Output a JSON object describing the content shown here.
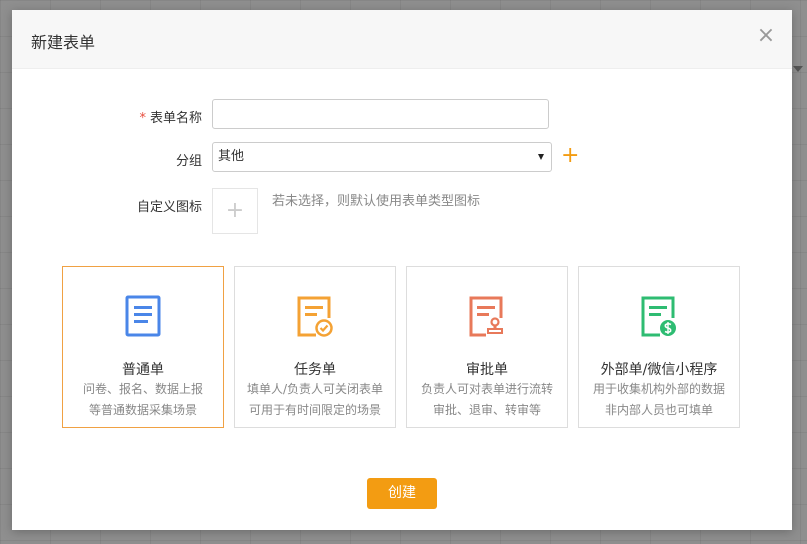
{
  "dialog": {
    "title": "新建表单",
    "close": "×"
  },
  "form": {
    "name_label": "表单名称",
    "required_mark": "*",
    "name_value": "",
    "group_label": "分组",
    "group_value": "其他",
    "add_group": "+",
    "icon_label": "自定义图标",
    "icon_add": "+",
    "icon_hint": "若未选择，则默认使用表单类型图标"
  },
  "cards": [
    {
      "title": "普通单",
      "desc1": "问卷、报名、数据上报",
      "desc2": "等普通数据采集场景",
      "icon": "document-icon",
      "color": "#4a86e8",
      "selected": true
    },
    {
      "title": "任务单",
      "desc1": "填单人/负责人可关闭表单",
      "desc2": "可用于有时间限定的场景",
      "icon": "task-check-icon",
      "color": "#f4a234",
      "selected": false
    },
    {
      "title": "审批单",
      "desc1": "负责人可对表单进行流转",
      "desc2": "审批、退审、转审等",
      "icon": "approval-stamp-icon",
      "color": "#e8795a",
      "selected": false
    },
    {
      "title": "外部单/微信小程序",
      "desc1": "用于收集机构外部的数据",
      "desc2": "非内部人员也可填单",
      "icon": "external-dollar-icon",
      "color": "#2ebc72",
      "selected": false
    }
  ],
  "actions": {
    "create_label": "创建"
  }
}
